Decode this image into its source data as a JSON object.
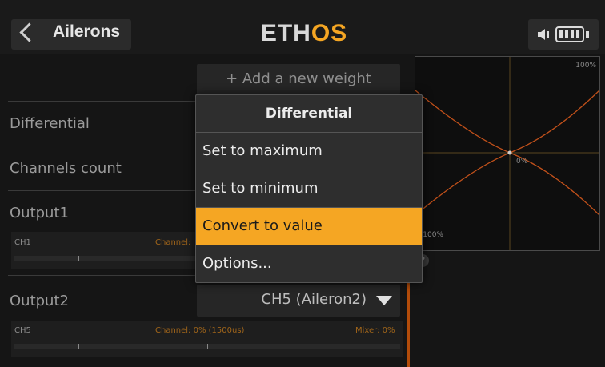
{
  "header": {
    "back_title": "Ailerons",
    "logo_main": "ETH",
    "logo_accent": "OS"
  },
  "list": {
    "add_weight_label": "+ Add a new weight",
    "differential_label": "Differential",
    "channels_count_label": "Channels count",
    "output1_label": "Output1",
    "output2_label": "Output2",
    "output2_value": "CH5 (Aileron2)"
  },
  "bars": [
    {
      "channel": "CH1",
      "channel_text": "Channel:",
      "mixer_text": ""
    },
    {
      "channel": "CH5",
      "channel_text": "Channel: 0% (1500us)",
      "mixer_text": "Mixer: 0%"
    }
  ],
  "graph": {
    "top_label": "100%",
    "center_label": "0%",
    "bottom_label": "-100%"
  },
  "popup": {
    "title": "Differential",
    "items": [
      {
        "label": "Set to maximum",
        "selected": false
      },
      {
        "label": "Set to minimum",
        "selected": false
      },
      {
        "label": "Convert to value",
        "selected": true
      },
      {
        "label": "Options...",
        "selected": false
      }
    ]
  },
  "help_icon_text": "?",
  "colors": {
    "accent": "#f5a623",
    "background": "#151515",
    "popup_bg": "#2e2e2e",
    "curve": "#c0501a"
  }
}
